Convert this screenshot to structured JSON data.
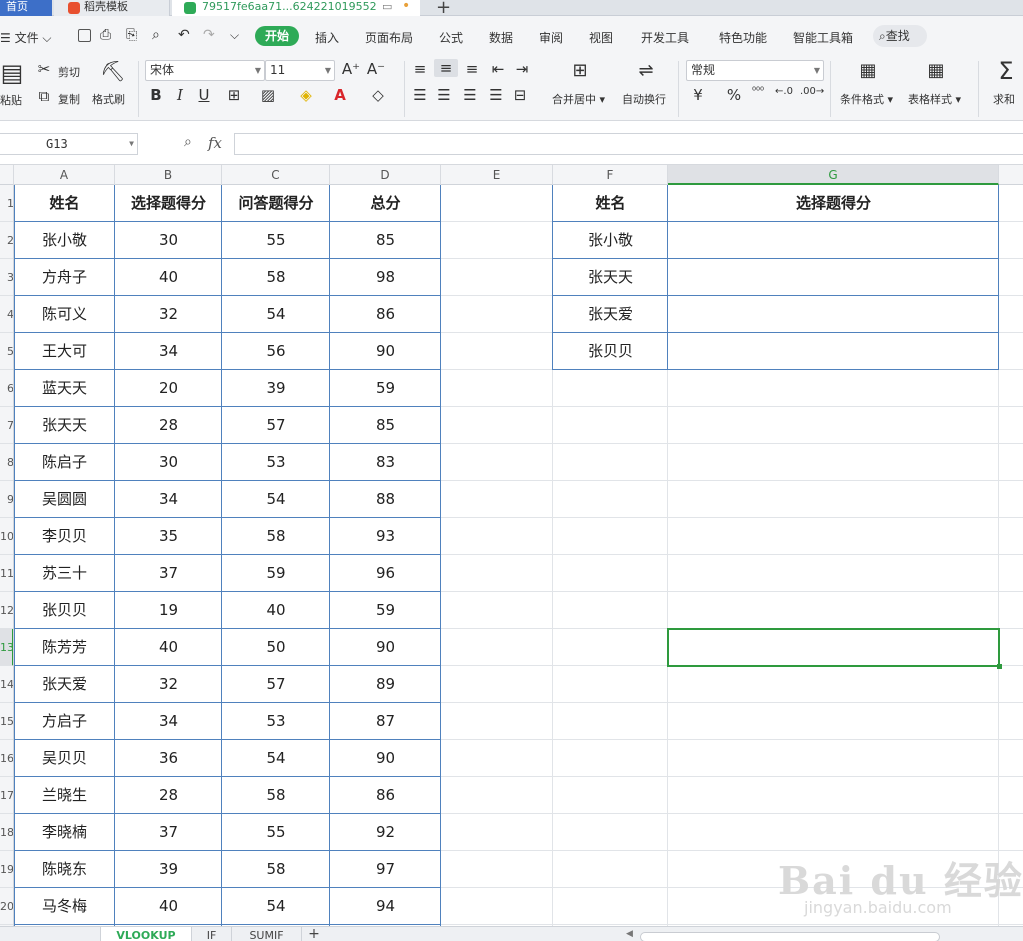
{
  "window_tabs": {
    "home": "首页",
    "templates": "稻壳模板",
    "file": "79517fe6aa71...624221019552"
  },
  "menus": [
    "文件",
    "开始",
    "插入",
    "页面布局",
    "公式",
    "数据",
    "审阅",
    "视图",
    "开发工具",
    "特色功能",
    "智能工具箱"
  ],
  "search_label": "查找",
  "ribbon": {
    "paste": "粘贴",
    "cut": "剪切",
    "copy": "复制",
    "format_painter": "格式刷",
    "font_name": "宋体",
    "font_size": "11",
    "number_format": "常规",
    "merge_center": "合并居中",
    "wrap_text": "自动换行",
    "conditional_format": "条件格式",
    "table_style": "表格样式",
    "sum": "求和",
    "currency_symbol": "¥",
    "percent_symbol": "%"
  },
  "formula_bar": {
    "name_box": "G13",
    "fx": "fx",
    "value": ""
  },
  "columns": [
    "A",
    "B",
    "C",
    "D",
    "E",
    "F",
    "G"
  ],
  "row_numbers": [
    "1",
    "2",
    "3",
    "4",
    "5",
    "6",
    "7",
    "8",
    "9",
    "10",
    "11",
    "12",
    "13",
    "14",
    "15",
    "16",
    "17",
    "18",
    "19",
    "20"
  ],
  "main_table": {
    "headers": [
      "姓名",
      "选择题得分",
      "问答题得分",
      "总分"
    ],
    "rows": [
      [
        "张小敬",
        "30",
        "55",
        "85"
      ],
      [
        "方舟子",
        "40",
        "58",
        "98"
      ],
      [
        "陈可义",
        "32",
        "54",
        "86"
      ],
      [
        "王大可",
        "34",
        "56",
        "90"
      ],
      [
        "蓝天天",
        "20",
        "39",
        "59"
      ],
      [
        "张天天",
        "28",
        "57",
        "85"
      ],
      [
        "陈启子",
        "30",
        "53",
        "83"
      ],
      [
        "吴圆圆",
        "34",
        "54",
        "88"
      ],
      [
        "李贝贝",
        "35",
        "58",
        "93"
      ],
      [
        "苏三十",
        "37",
        "59",
        "96"
      ],
      [
        "张贝贝",
        "19",
        "40",
        "59"
      ],
      [
        "陈芳芳",
        "40",
        "50",
        "90"
      ],
      [
        "张天爱",
        "32",
        "57",
        "89"
      ],
      [
        "方启子",
        "34",
        "53",
        "87"
      ],
      [
        "吴贝贝",
        "36",
        "54",
        "90"
      ],
      [
        "兰晓生",
        "28",
        "58",
        "86"
      ],
      [
        "李晓楠",
        "37",
        "55",
        "92"
      ],
      [
        "陈晓东",
        "39",
        "58",
        "97"
      ],
      [
        "马冬梅",
        "40",
        "54",
        "94"
      ]
    ]
  },
  "lookup_table": {
    "headers": [
      "姓名",
      "选择题得分"
    ],
    "rows": [
      [
        "张小敬",
        ""
      ],
      [
        "张天天",
        ""
      ],
      [
        "张天爱",
        ""
      ],
      [
        "张贝贝",
        ""
      ]
    ]
  },
  "sheet_tabs": [
    "VLOOKUP",
    "IF",
    "SUMIF"
  ],
  "watermark": {
    "text": "Bai du 经验",
    "url": "jingyan.baidu.com"
  },
  "colors": {
    "accent_green": "#2eaa57",
    "table_border": "#4f81bd",
    "selection": "#2e9a3e"
  }
}
